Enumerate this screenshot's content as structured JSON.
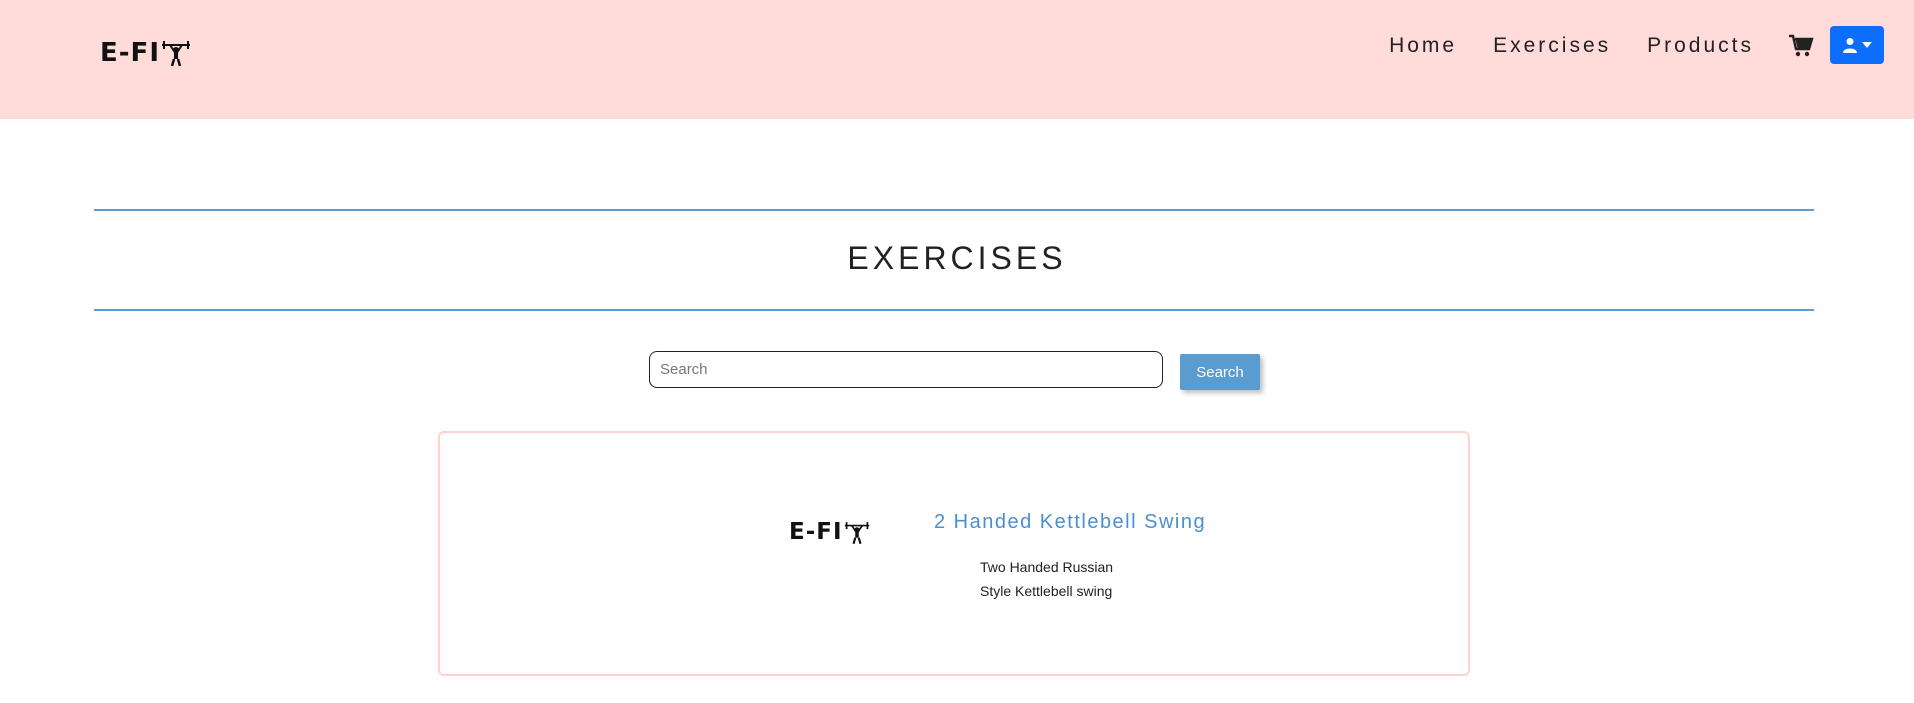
{
  "header": {
    "logo_text": "E-FI",
    "nav": [
      {
        "label": "Home"
      },
      {
        "label": "Exercises"
      },
      {
        "label": "Products"
      }
    ],
    "icons": {
      "cart": "shopping-cart-icon",
      "user": "user-icon",
      "dropdown": "caret-down-icon"
    },
    "colors": {
      "navbar_bg": "#ffdcd9",
      "user_button": "#0d6efd"
    }
  },
  "main": {
    "title": "EXERCISES",
    "search": {
      "placeholder": "Search",
      "value": "",
      "button_label": "Search"
    },
    "exercises": [
      {
        "logo_text": "E-FI",
        "title": "2 Handed Kettlebell Swing",
        "description": "Two Handed Russian Style Kettlebell swing"
      }
    ],
    "colors": {
      "accent": "#5a9bd0",
      "card_border": "#ffd2cf"
    }
  }
}
